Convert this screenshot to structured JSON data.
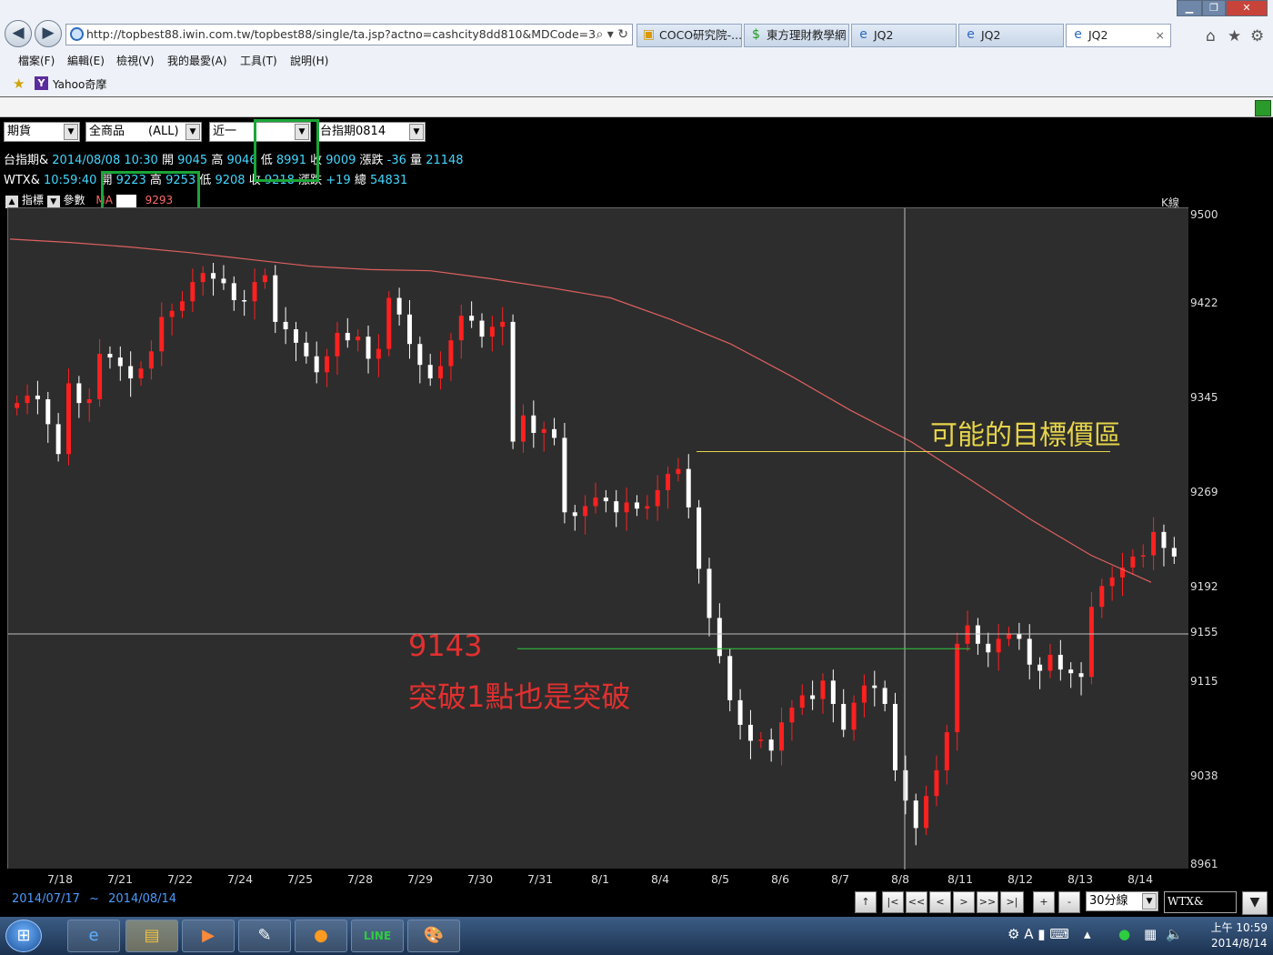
{
  "browser": {
    "url": "http://topbest88.iwin.com.tw/topbest88/single/ta.jsp?actno=cashcity8dd810&MDCode=33942",
    "tabs": [
      {
        "title": "COCO研究院-..."
      },
      {
        "title": "東方理財教學網"
      },
      {
        "title": "JQ2"
      },
      {
        "title": "JQ2"
      },
      {
        "title": "JQ2"
      }
    ],
    "menu": [
      "檔案(F)",
      "編輯(E)",
      "檢視(V)",
      "我的最愛(A)",
      "工具(T)",
      "說明(H)"
    ],
    "favorite": "Yahoo奇摩"
  },
  "toolbar": {
    "market": "期貨",
    "category": "全商品",
    "category_tag": "(ALL)",
    "period": "近一",
    "period_value": "",
    "contract": "台指期0814"
  },
  "quote1": {
    "symbol": "台指期&",
    "datetime": "2014/08/08 10:30",
    "open_label": "開",
    "open": "9045",
    "high_label": "高",
    "high": "9046",
    "low_label": "低",
    "low": "8991",
    "close_label": "收",
    "close": "9009",
    "change_label": "漲跌",
    "change": "-36",
    "volume_label": "量",
    "volume": "21148"
  },
  "quote2": {
    "symbol": "WTX&",
    "time": "10:59:40",
    "open_label": "開",
    "open": "9223",
    "high_label": "高",
    "high": "9253",
    "low_label": "低",
    "low": "9208",
    "close_label": "收",
    "close": "9218",
    "change_label": "漲跌",
    "change": "+19",
    "volume_label": "總",
    "volume": "54831"
  },
  "indicator": {
    "tab1": "指標",
    "tab2": "參數",
    "ma_label": "MA",
    "ma_value": "9293"
  },
  "chart_meta": {
    "type_label": "K線"
  },
  "chart_data": {
    "type": "candlestick",
    "yticks": [
      9500,
      9422,
      9345,
      9269,
      9192,
      9155,
      9115,
      9038,
      8961
    ],
    "ylim": [
      8961,
      9500
    ],
    "xticks": [
      "7/18",
      "7/21",
      "7/22",
      "7/24",
      "7/25",
      "7/28",
      "7/29",
      "7/30",
      "7/31",
      "8/1",
      "8/4",
      "8/5",
      "8/6",
      "8/7",
      "8/8",
      "8/11",
      "8/12",
      "8/13",
      "8/14"
    ],
    "ma_series": [
      9480,
      9477,
      9473,
      9468,
      9462,
      9456,
      9453,
      9452,
      9445,
      9437,
      9428,
      9410,
      9390,
      9364,
      9336,
      9311,
      9280,
      9248,
      9219,
      9197
    ],
    "annotations": [
      {
        "text": "可能的目標價區",
        "price": 9303
      },
      {
        "text": "9143",
        "price": 9143
      },
      {
        "text": "突破1點也是突破"
      }
    ],
    "crosshair_price": 9155,
    "closes": [
      9342,
      9348,
      9345,
      9325,
      9301,
      9358,
      9342,
      9345,
      9382,
      9379,
      9372,
      9362,
      9370,
      9384,
      9412,
      9417,
      9425,
      9442,
      9450,
      9445,
      9441,
      9426,
      9425,
      9442,
      9448,
      9408,
      9402,
      9391,
      9380,
      9367,
      9380,
      9399,
      9393,
      9396,
      9378,
      9386,
      9428,
      9414,
      9390,
      9373,
      9362,
      9372,
      9393,
      9413,
      9409,
      9396,
      9404,
      9408,
      9311,
      9332,
      9318,
      9321,
      9314,
      9254,
      9251,
      9259,
      9266,
      9263,
      9254,
      9262,
      9257,
      9259,
      9272,
      9285,
      9289,
      9258,
      9208,
      9168,
      9137,
      9101,
      9081,
      9068,
      9069,
      9060,
      9083,
      9095,
      9105,
      9102,
      9117,
      9098,
      9077,
      9099,
      9113,
      9111,
      9098,
      9044,
      9018,
      8994,
      9022,
      9044,
      9075,
      9147,
      9162,
      9147,
      9140,
      9151,
      9155,
      9151,
      9130,
      9125,
      9138,
      9126,
      9123,
      9120,
      9177,
      9194,
      9201,
      9209,
      9218,
      9219,
      9238,
      9225,
      9218
    ]
  },
  "date_range": {
    "from": "2014/07/17",
    "sep": "~",
    "to": "2014/08/14"
  },
  "controls": {
    "interval": "30分線",
    "symbol_box": "WTX&",
    "buttons": [
      "↑",
      "|<",
      "<<",
      "<",
      ">",
      ">>",
      ">|",
      "+",
      "-"
    ]
  },
  "taskbar": {
    "time": "上午 10:59",
    "date": "2014/8/14"
  }
}
